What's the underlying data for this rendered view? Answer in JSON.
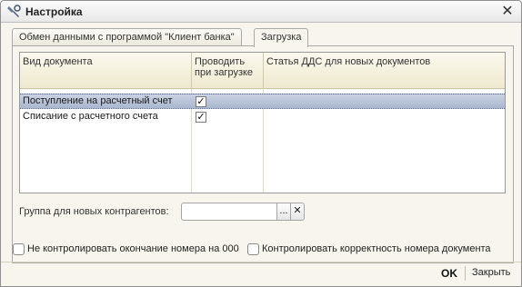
{
  "window": {
    "title": "Настройка"
  },
  "tabs": [
    {
      "label": "Обмен данными с программой \"Клиент банка\"",
      "active": false
    },
    {
      "label": "Загрузка",
      "active": true
    }
  ],
  "table": {
    "columns": {
      "doc_type": "Вид документа",
      "post_on_load_line1": "Проводить",
      "post_on_load_line2": "при загрузке",
      "dds_article": "Статья ДДС для новых документов"
    },
    "rows": [
      {
        "doc_type": "Поступление на расчетный счет",
        "post_on_load": true,
        "dds_article": "",
        "selected": true
      },
      {
        "doc_type": "Списание с расчетного счета",
        "post_on_load": true,
        "dds_article": "",
        "selected": false
      }
    ]
  },
  "group_field": {
    "label": "Группа для новых контрагентов:",
    "value": "",
    "select_button": "...",
    "clear_button": "✕"
  },
  "options": {
    "no_check_number_end": {
      "label": "Не контролировать окончание номера на 000",
      "checked": false
    },
    "check_number_correctness": {
      "label": "Контролировать корректность номера документа",
      "checked": false
    }
  },
  "footer": {
    "ok_label": "OK",
    "close_label": "Закрыть"
  },
  "colors": {
    "selected_row": "#b3bfd4",
    "header_bg": "#efe9cf",
    "panel_bg": "#f7f5ee"
  },
  "icons": {
    "app": "settings-wrench-icon",
    "close": "close-icon",
    "checkmark": "check-icon"
  }
}
